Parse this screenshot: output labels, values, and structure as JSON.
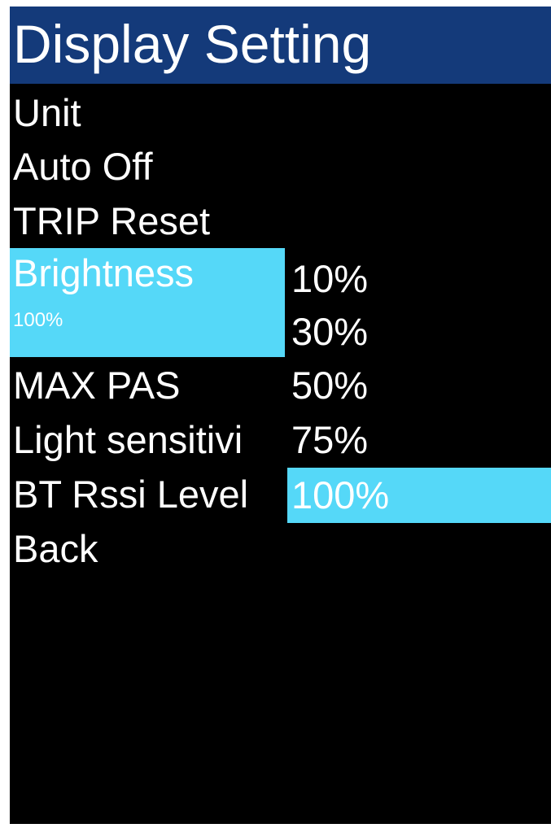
{
  "header": {
    "title": "Display Setting"
  },
  "menu": {
    "items": [
      {
        "label": "Unit"
      },
      {
        "label": "Auto Off"
      },
      {
        "label": "TRIP Reset"
      },
      {
        "label": "Brightness",
        "value": "100%"
      },
      {
        "label": "MAX PAS"
      },
      {
        "label": "Light sensitivi"
      },
      {
        "label": "BT Rssi Level"
      },
      {
        "label": "Back"
      }
    ],
    "selected_index": 3
  },
  "brightness_options": {
    "items": [
      "10%",
      "30%",
      "50%",
      "75%",
      "100%"
    ],
    "selected": "100%"
  },
  "colors": {
    "header_bg": "#143a7a",
    "highlight": "#55d8f8",
    "background": "#000000",
    "text": "#ffffff"
  }
}
